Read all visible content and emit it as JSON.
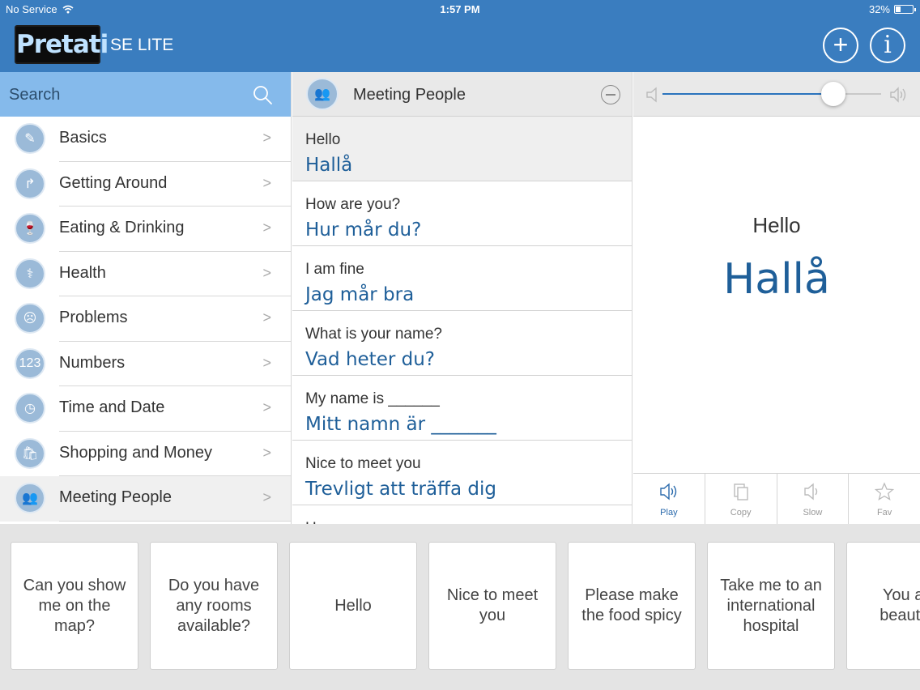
{
  "status_bar": {
    "carrier": "No Service",
    "time": "1:57 PM",
    "battery": "32%",
    "battery_level": 0.32
  },
  "header": {
    "logo": "Pretati",
    "subtitle": "SE LITE",
    "add_label": "+",
    "info_label": "i"
  },
  "search": {
    "label": "Search"
  },
  "categories": [
    {
      "label": "Basics",
      "icon": "pencil-icon",
      "glyph": "✎",
      "chevron": ">"
    },
    {
      "label": "Getting Around",
      "icon": "turn-arrow-icon",
      "glyph": "↱",
      "chevron": ">"
    },
    {
      "label": "Eating & Drinking",
      "icon": "glass-icon",
      "glyph": "🍷",
      "chevron": ">"
    },
    {
      "label": "Health",
      "icon": "stethoscope-icon",
      "glyph": "⚕",
      "chevron": ">"
    },
    {
      "label": "Problems",
      "icon": "sad-face-icon",
      "glyph": "☹",
      "chevron": ">"
    },
    {
      "label": "Numbers",
      "icon": "numbers-icon",
      "glyph": "123",
      "chevron": ">"
    },
    {
      "label": "Time and Date",
      "icon": "clock-icon",
      "glyph": "◷",
      "chevron": ">"
    },
    {
      "label": "Shopping and Money",
      "icon": "shopping-bag-icon",
      "glyph": "🛍",
      "chevron": ">"
    },
    {
      "label": "Meeting People",
      "icon": "people-icon",
      "glyph": "👥",
      "chevron": ">"
    }
  ],
  "active_category": "Meeting People",
  "phrase_list": {
    "title": "Meeting People",
    "icon": "people-icon",
    "phrases": [
      {
        "en": "Hello",
        "se": "Hallå"
      },
      {
        "en": "How are you?",
        "se": "Hur mår du?"
      },
      {
        "en": "I am fine",
        "se": "Jag mår bra"
      },
      {
        "en": "What is your name?",
        "se": "Vad heter du?"
      },
      {
        "en": "My name is ______",
        "se": "Mitt namn är _______"
      },
      {
        "en": "Nice to meet you",
        "se": "Trevligt att träffa dig"
      },
      {
        "en": "How",
        "se": ""
      }
    ]
  },
  "volume": {
    "level": 0.78,
    "accent": "#2a73bd"
  },
  "detail": {
    "en": "Hello",
    "se": "Hallå"
  },
  "actions": [
    {
      "label": "Play",
      "icon": "speaker-icon",
      "active": true
    },
    {
      "label": "Copy",
      "icon": "copy-icon",
      "active": false
    },
    {
      "label": "Slow",
      "icon": "slow-speaker-icon",
      "active": false
    },
    {
      "label": "Fav",
      "icon": "star-icon",
      "active": false
    }
  ],
  "suggestions": [
    "Can you show me on the map?",
    "Do you have any rooms available?",
    "Hello",
    "Nice to meet you",
    "Please make the food spicy",
    "Take me to an international hospital",
    "You are beautiful"
  ],
  "colors": {
    "brand": "#3a7dbf",
    "search_bg": "#85baeb",
    "swedish_text": "#1f5f99"
  }
}
